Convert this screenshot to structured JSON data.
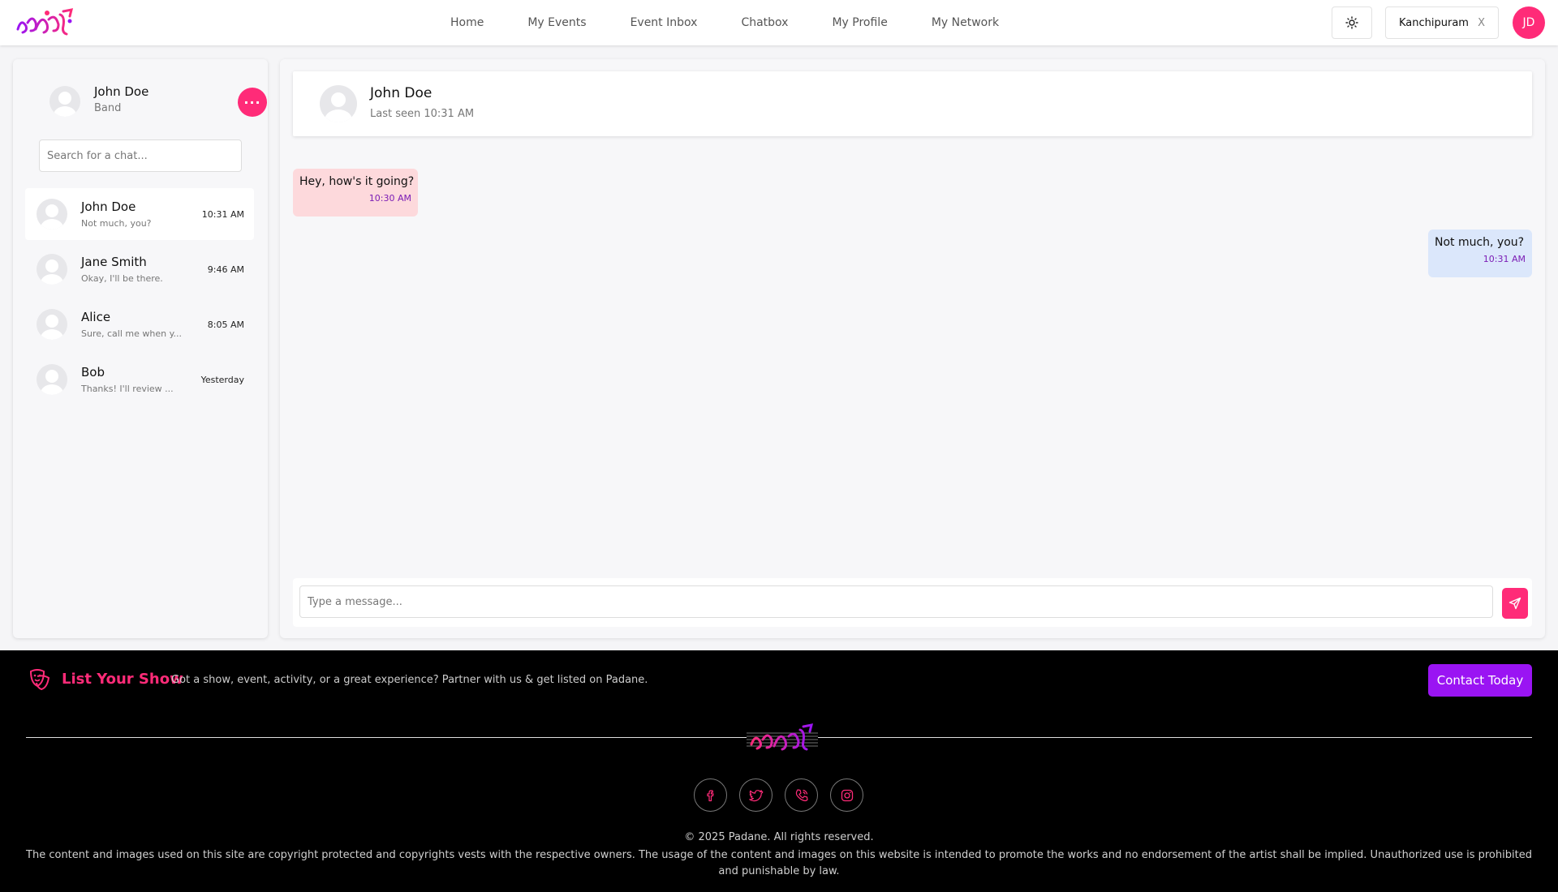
{
  "brand": {
    "logo_alt": "பதநீ",
    "accent": "#ff2b78",
    "purple": "#9a14f3"
  },
  "nav": {
    "items": [
      "Home",
      "My Events",
      "Event Inbox",
      "Chatbox",
      "My Profile",
      "My Network"
    ]
  },
  "header_right": {
    "theme_icon": "sun-icon",
    "location": "Kanchipuram",
    "location_clear": "X",
    "avatar_initials": "JD"
  },
  "sidebar": {
    "me_name": "John Doe",
    "me_role": "Band",
    "more_icon": "ellipsis-icon",
    "search_placeholder": "Search for a chat...",
    "chats": [
      {
        "name": "John Doe",
        "preview": "Not much, you?",
        "time": "10:31 AM",
        "active": true
      },
      {
        "name": "Jane Smith",
        "preview": "Okay, I'll be there.",
        "time": "9:46 AM",
        "active": false
      },
      {
        "name": "Alice",
        "preview": "Sure, call me when y...",
        "time": "8:05 AM",
        "active": false
      },
      {
        "name": "Bob",
        "preview": "Thanks! I'll review ...",
        "time": "Yesterday",
        "active": false
      }
    ]
  },
  "conversation": {
    "name": "John Doe",
    "last_seen": "Last seen 10:31 AM",
    "messages": [
      {
        "direction": "in",
        "text": "Hey, how's it going?",
        "time": "10:30 AM"
      },
      {
        "direction": "out",
        "text": "Not much, you?",
        "time": "10:31 AM"
      }
    ],
    "input_placeholder": "Type a message...",
    "send_icon": "send-icon"
  },
  "footer": {
    "list_title": "List Your Show",
    "list_desc": "Got a show, event, activity, or a great experience? Partner with us & get listed on Padane.",
    "contact_label": "Contact Today",
    "socials": [
      "facebook-icon",
      "twitter-icon",
      "phone-icon",
      "instagram-icon"
    ],
    "copyright": "© 2025 Padane. All rights reserved.",
    "disclaimer": "The content and images used on this site are copyright protected and copyrights vests with the respective owners. The usage of the content and images on this website is intended to promote the works and no endorsement of the artist shall be implied. Unauthorized use is prohibited and punishable by law."
  }
}
